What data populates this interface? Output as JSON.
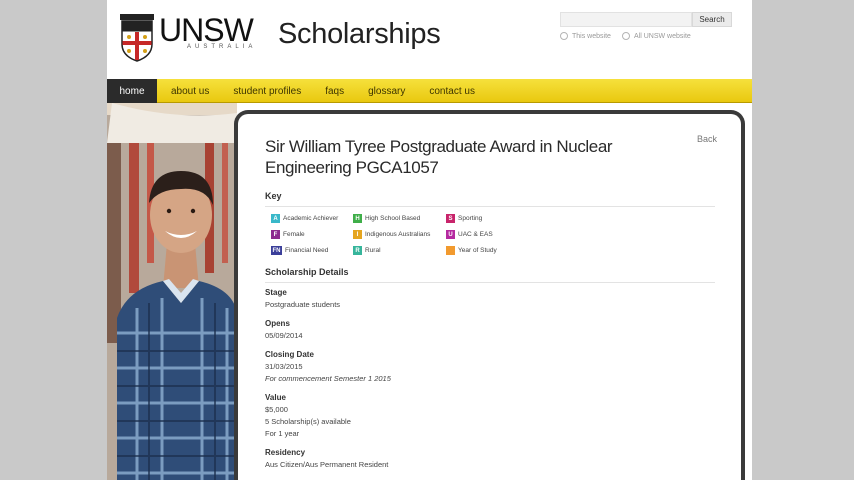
{
  "header": {
    "logo": "UNSW",
    "logo_sub": "AUSTRALIA",
    "site_title": "Scholarships",
    "search": {
      "button_label": "Search",
      "value": ""
    },
    "scope_options": [
      "This website",
      "All UNSW website"
    ]
  },
  "nav": [
    "home",
    "about us",
    "student profiles",
    "faqs",
    "glossary",
    "contact us"
  ],
  "content": {
    "back_label": "Back",
    "title": "Sir William Tyree Postgraduate Award in Nuclear Engineering PGCA1057",
    "key_heading": "Key",
    "key": [
      {
        "code": "A",
        "label": "Academic Achiever",
        "color": "#39b8c9"
      },
      {
        "code": "H",
        "label": "High School Based",
        "color": "#3fae49"
      },
      {
        "code": "S",
        "label": "Sporting",
        "color": "#c8246b"
      },
      {
        "code": "F",
        "label": "Female",
        "color": "#8d2b8f"
      },
      {
        "code": "I",
        "label": "Indigenous Australians",
        "color": "#e5a520"
      },
      {
        "code": "U",
        "label": "UAC & EAS",
        "color": "#b52aa0"
      },
      {
        "code": "FN",
        "label": "Financial Need",
        "color": "#3b3f9a"
      },
      {
        "code": "R",
        "label": "Rural",
        "color": "#36b59b"
      },
      {
        "code": "",
        "label": "Year of Study",
        "color": "#f29a2e"
      }
    ],
    "details_heading": "Scholarship Details",
    "details": [
      {
        "label": "Stage",
        "values": [
          "Postgraduate students"
        ]
      },
      {
        "label": "Opens",
        "values": [
          "05/09/2014"
        ]
      },
      {
        "label": "Closing Date",
        "values": [
          "31/03/2015",
          "For commencement Semester 1 2015"
        ]
      },
      {
        "label": "Value",
        "values": [
          "$5,000",
          "5 Scholarship(s) available",
          "For 1 year"
        ]
      },
      {
        "label": "Residency",
        "values": [
          "Aus Citizen/Aus Permanent Resident"
        ]
      }
    ]
  }
}
